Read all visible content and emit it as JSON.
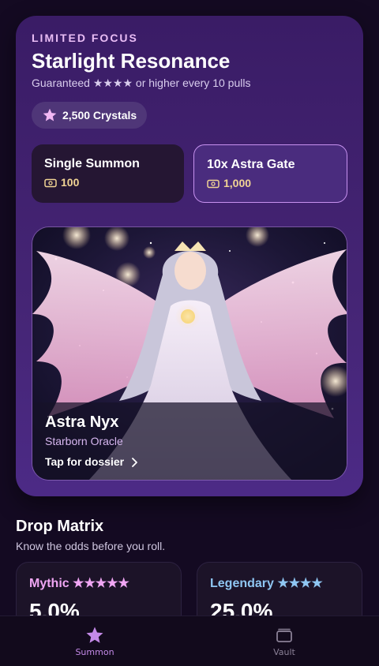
{
  "banner": {
    "eyebrow": "LIMITED FOCUS",
    "title": "Starlight Resonance",
    "subtitle": "Guaranteed ★★★★ or higher every 10 pulls",
    "currency": {
      "icon": "star-icon",
      "label": "2,500 Crystals"
    },
    "summon_options": [
      {
        "label": "Single Summon",
        "icon": "ticket-icon",
        "cost": "100"
      },
      {
        "label": "10x Astra Gate",
        "icon": "ticket-icon",
        "cost": "1,000"
      }
    ],
    "featured": {
      "name": "Astra Nyx",
      "role": "Starborn Oracle",
      "link_label": "Tap for dossier",
      "link_icon": "chevron-right-icon"
    }
  },
  "drop_matrix": {
    "title": "Drop Matrix",
    "subtitle": "Know the odds before you roll.",
    "tiers": [
      {
        "label": "Mythic ★★★★★",
        "value": "5.0%",
        "color": "#f0a6f4"
      },
      {
        "label": "Legendary ★★★★",
        "value": "25.0%",
        "color": "#8fc6f2"
      }
    ]
  },
  "tabbar": {
    "items": [
      {
        "label": "Summon",
        "icon": "star-icon",
        "active": true,
        "color": "#c48ae8"
      },
      {
        "label": "Vault",
        "icon": "vault-icon",
        "active": false,
        "color": "#8a8096"
      }
    ]
  },
  "colors": {
    "accent": "#c792f0",
    "cost_gold": "#f1d494",
    "card_bg": "#3a1c66"
  }
}
